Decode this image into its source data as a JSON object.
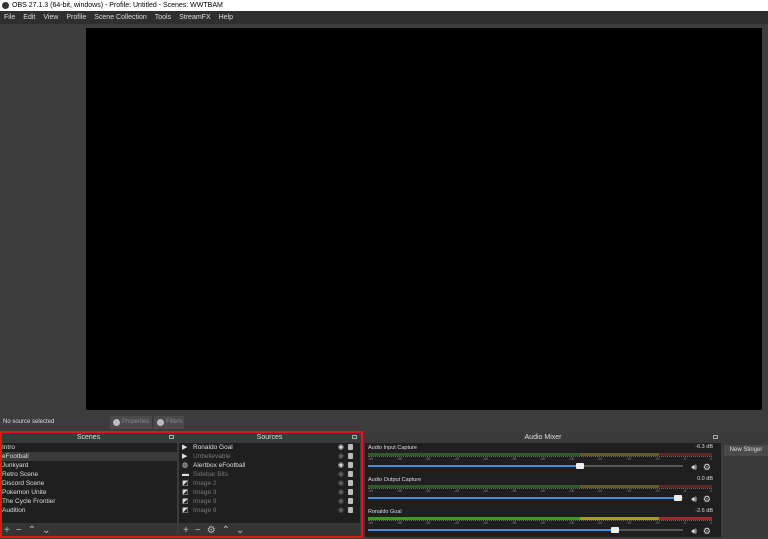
{
  "window": {
    "title": "OBS 27.1.3 (64-bit, windows) - Profile: Untitled - Scenes: WWTBAM"
  },
  "menu": [
    "File",
    "Edit",
    "View",
    "Profile",
    "Scene Collection",
    "Tools",
    "StreamFX",
    "Help"
  ],
  "status": {
    "no_source": "No source selected",
    "properties": "Properties",
    "filters": "Filters"
  },
  "scenes": {
    "title": "Scenes",
    "items": [
      "Intro",
      "eFootball",
      "Junkyard",
      "Retro Scene",
      "Discord Scene",
      "Pokemon Unite",
      "The Cycle Frontier",
      "Audition"
    ],
    "selected": 1
  },
  "sources": {
    "title": "Sources",
    "items": [
      {
        "name": "Ronaldo Goal",
        "icon": "play-icon",
        "visible": true
      },
      {
        "name": "Unbelievable",
        "icon": "play-icon",
        "visible": false
      },
      {
        "name": "Alertbox eFootball",
        "icon": "globe-icon",
        "visible": true
      },
      {
        "name": "Sidebar Bits",
        "icon": "folder-icon",
        "visible": false
      },
      {
        "name": "Image 2",
        "icon": "image-icon",
        "visible": false
      },
      {
        "name": "Image 3",
        "icon": "image-icon",
        "visible": false
      },
      {
        "name": "Image 9",
        "icon": "image-icon",
        "visible": false
      },
      {
        "name": "Image 9",
        "icon": "image-icon",
        "visible": false
      }
    ]
  },
  "mixer": {
    "title": "Audio Mixer",
    "ticks": [
      "-60",
      "-55",
      "-50",
      "-45",
      "-40",
      "-35",
      "-30",
      "-25",
      "-20",
      "-15",
      "-10",
      "-5",
      "0"
    ],
    "channels": [
      {
        "name": "Audio Input Capture",
        "db": "-6.3 dB",
        "volume": 0.68
      },
      {
        "name": "Audio Output Capture",
        "db": "0.0 dB",
        "volume": 0.99
      },
      {
        "name": "Ronaldo Goal",
        "db": "-2.6 dB",
        "volume": 0.79
      }
    ]
  },
  "transitions": {
    "new_stinger": "New Stinger"
  },
  "colors": {
    "accent": "#3d8ee8",
    "highlight": "#e0161b",
    "meter_green": "#3a9a2a",
    "meter_yellow": "#a59a2a",
    "meter_red": "#a02a2a"
  }
}
